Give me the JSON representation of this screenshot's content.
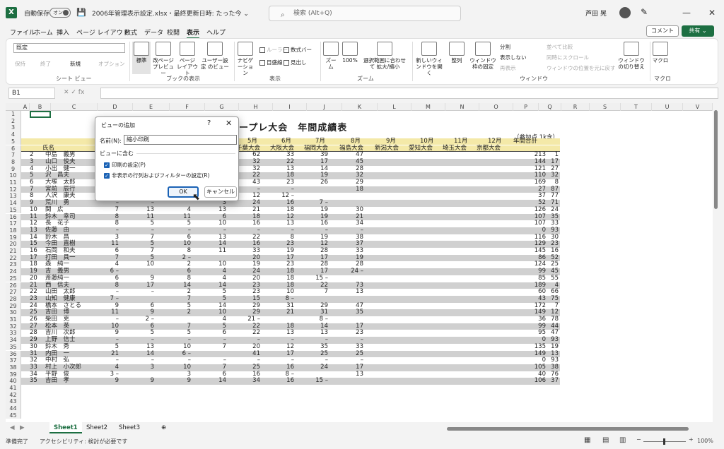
{
  "titlebar": {
    "logo": "X",
    "autosave": "自動保存",
    "toggle": "オン",
    "save_icon": "save-icon",
    "doc_title": "2006年管理表示設定.xlsx・最終更新日時: たった今 ⌄",
    "search_placeholder": "検索 (Alt+Q)",
    "user": "芦田 晃",
    "win_min": "—",
    "win_max": "☐",
    "win_close": "✕"
  },
  "menu": [
    "ファイル",
    "ホーム",
    "挿入",
    "ページ レイアウト",
    "数式",
    "データ",
    "校閲",
    "表示",
    "ヘルプ"
  ],
  "menu_active": "表示",
  "comment_btn": "コメント",
  "share_btn": "共有 ⌄",
  "ribbon": {
    "view_select": "既定",
    "sheetview_small": [
      "保持",
      "終了",
      "新規",
      "オプション"
    ],
    "sheetview_label": "シート ビュー",
    "book_buttons": [
      "標準",
      "改ページ プレビュー",
      "ページ レイアウト",
      "ユーザー設定 のビュー"
    ],
    "book_label": "ブックの表示",
    "show_items": [
      "ナビゲーション",
      "ルーラー",
      "数式バー",
      "目盛線",
      "見出し"
    ],
    "show_label": "表示",
    "zoom_buttons": [
      "ズーム",
      "100%",
      "選択範囲に合わせて 拡大/縮小"
    ],
    "zoom_label": "ズーム",
    "window_buttons": [
      "新しいウィンドウを開く",
      "整列",
      "ウィンドウ枠の固定"
    ],
    "window_small": [
      "分割",
      "表示しない",
      "再表示",
      "並べて比較",
      "同時にスクロール",
      "ウィンドウの位置を元に戻す"
    ],
    "window_switch": "ウィンドウの切り替え",
    "window_label": "ウィンドウ",
    "macro": "マクロ",
    "macro_label": "マクロ"
  },
  "formula": {
    "namebox": "B1",
    "fx": "✕  ✓  fx",
    "value": ""
  },
  "columns": [
    "A",
    "B",
    "C",
    "D",
    "E",
    "F",
    "G",
    "H",
    "I",
    "J",
    "K",
    "L",
    "M",
    "N",
    "O",
    "P",
    "Q",
    "R",
    "S",
    "T",
    "U",
    "V"
  ],
  "sheet_title": "ープレ大会　年間成績表",
  "note": "（参加点 1k含）",
  "header_months": [
    "5月",
    "6月",
    "7月",
    "8月",
    "9月",
    "10月",
    "11月",
    "12月"
  ],
  "header_venues": [
    "千葉大会",
    "大阪大会",
    "福岡大会",
    "福島大会",
    "新潟大会",
    "愛知大会",
    "埼玉大会",
    "京都大会"
  ],
  "header_total": "年間合計",
  "header_name": "氏名",
  "rows": [
    {
      "n": "2",
      "name": "中島　義男",
      "v": [
        "",
        "",
        "",
        "",
        "62",
        "33",
        "39",
        "47"
      ],
      "t": "213",
      "r": "1"
    },
    {
      "n": "3",
      "name": "山口　俊夫",
      "v": [
        "",
        "",
        "",
        "",
        "32",
        "22",
        "17",
        "45"
      ],
      "t": "144",
      "r": "17"
    },
    {
      "n": "4",
      "name": "小出　健一",
      "v": [
        "",
        "",
        "",
        "",
        "32",
        "13",
        "14",
        "28"
      ],
      "t": "121",
      "r": "27"
    },
    {
      "n": "5",
      "name": "沢　昌夫",
      "v": [
        "",
        "",
        "",
        "",
        "22",
        "18",
        "19",
        "32"
      ],
      "t": "110",
      "r": "32"
    },
    {
      "n": "6",
      "name": "大塚　太郎",
      "v": [
        "",
        "",
        "",
        "",
        "43",
        "23",
        "26",
        "29"
      ],
      "t": "169",
      "r": "8"
    },
    {
      "n": "7",
      "name": "宮前　辰行",
      "v": [
        "",
        "",
        "",
        "–",
        "–",
        "–",
        "",
        "18"
      ],
      "t": "27",
      "r": "87"
    },
    {
      "n": "8",
      "name": "人沢　康夫",
      "v": [
        "–",
        "",
        "11",
        "3 –",
        "12",
        "12 –",
        "",
        ""
      ],
      "t": "37",
      "r": "77"
    },
    {
      "n": "9",
      "name": "荒川　勇",
      "v": [
        "–",
        "–",
        "",
        "3",
        "24",
        "16",
        "7 –",
        ""
      ],
      "t": "52",
      "r": "71"
    },
    {
      "n": "10",
      "name": "関　広",
      "v": [
        "7",
        "13",
        "4",
        "13",
        "21",
        "18",
        "19",
        "30"
      ],
      "t": "126",
      "r": "24"
    },
    {
      "n": "11",
      "name": "鈴木　幸司",
      "v": [
        "8",
        "11",
        "11",
        "6",
        "18",
        "12",
        "19",
        "21"
      ],
      "t": "107",
      "r": "35"
    },
    {
      "n": "12",
      "name": "長　花子",
      "v": [
        "8",
        "5",
        "5",
        "10",
        "16",
        "13",
        "16",
        "34"
      ],
      "t": "107",
      "r": "33"
    },
    {
      "n": "13",
      "name": "佐藤　由",
      "v": [
        "–",
        "–",
        "–",
        "–",
        "–",
        "–",
        "–",
        "–"
      ],
      "t": "0",
      "r": "93"
    },
    {
      "n": "14",
      "name": "鈴木　昌",
      "v": [
        "3",
        "7",
        "6",
        "13",
        "22",
        "8",
        "19",
        "38"
      ],
      "t": "116",
      "r": "30"
    },
    {
      "n": "15",
      "name": "今田　直樹",
      "v": [
        "11",
        "5",
        "10",
        "14",
        "16",
        "23",
        "12",
        "37"
      ],
      "t": "129",
      "r": "23"
    },
    {
      "n": "16",
      "name": "石岡　和夫",
      "v": [
        "6",
        "7",
        "8",
        "11",
        "33",
        "19",
        "28",
        "33"
      ],
      "t": "145",
      "r": "16"
    },
    {
      "n": "17",
      "name": "打田　具一",
      "v": [
        "7",
        "5",
        "2 –",
        "",
        "20",
        "17",
        "17",
        "19"
      ],
      "t": "86",
      "r": "52"
    },
    {
      "n": "18",
      "name": "森　純一",
      "v": [
        "4",
        "10",
        "2",
        "10",
        "19",
        "23",
        "28",
        "28"
      ],
      "t": "124",
      "r": "25"
    },
    {
      "n": "19",
      "name": "吉　義男",
      "v": [
        "6 –",
        "",
        "6",
        "4",
        "24",
        "18",
        "17",
        "24 –"
      ],
      "t": "99",
      "r": "45"
    },
    {
      "n": "20",
      "name": "斎藤純一",
      "v": [
        "6",
        "9",
        "8",
        "4",
        "20",
        "18",
        "15 –",
        ""
      ],
      "t": "85",
      "r": "55"
    },
    {
      "n": "21",
      "name": "西　信夫",
      "v": [
        "8",
        "17",
        "14",
        "14",
        "23",
        "18",
        "22",
        "73"
      ],
      "t": "189",
      "r": "4"
    },
    {
      "n": "22",
      "name": "山田　太郎",
      "v": [
        "–",
        "–",
        "2",
        "5",
        "23",
        "10",
        "7",
        "13"
      ],
      "t": "60",
      "r": "66"
    },
    {
      "n": "23",
      "name": "山知　健康",
      "v": [
        "7 –",
        "",
        "7",
        "5",
        "15",
        "8 –",
        "",
        ""
      ],
      "t": "43",
      "r": "75"
    },
    {
      "n": "24",
      "name": "橋本　さとる",
      "v": [
        "9",
        "6",
        "5",
        "14",
        "29",
        "31",
        "29",
        "47"
      ],
      "t": "172",
      "r": "7"
    },
    {
      "n": "25",
      "name": "吉田　博",
      "v": [
        "11",
        "9",
        "2",
        "10",
        "29",
        "21",
        "31",
        "35"
      ],
      "t": "149",
      "r": "12"
    },
    {
      "n": "26",
      "name": "柴田　克",
      "v": [
        "–",
        "2 –",
        "",
        "4",
        "21 –",
        "",
        "8 –",
        ""
      ],
      "t": "36",
      "r": "78"
    },
    {
      "n": "27",
      "name": "松本　英",
      "v": [
        "10",
        "6",
        "7",
        "5",
        "22",
        "18",
        "14",
        "17"
      ],
      "t": "99",
      "r": "44"
    },
    {
      "n": "28",
      "name": "吉川　次郎",
      "v": [
        "9",
        "5",
        "5",
        "6",
        "22",
        "13",
        "13",
        "23"
      ],
      "t": "95",
      "r": "47"
    },
    {
      "n": "29",
      "name": "上野　信士",
      "v": [
        "–",
        "–",
        "–",
        "–",
        "–",
        "–",
        "–",
        "–"
      ],
      "t": "0",
      "r": "93"
    },
    {
      "n": "30",
      "name": "鈴木　秀",
      "v": [
        "5",
        "13",
        "10",
        "7",
        "20",
        "12",
        "35",
        "33"
      ],
      "t": "135",
      "r": "19"
    },
    {
      "n": "31",
      "name": "内田　一",
      "v": [
        "21",
        "14",
        "6 –",
        "",
        "41",
        "17",
        "25",
        "25"
      ],
      "t": "149",
      "r": "13"
    },
    {
      "n": "32",
      "name": "中村　弘",
      "v": [
        "–",
        "–",
        "–",
        "–",
        "–",
        "–",
        "–",
        "–"
      ],
      "t": "0",
      "r": "93"
    },
    {
      "n": "33",
      "name": "村上　小次郎",
      "v": [
        "4",
        "3",
        "10",
        "7",
        "25",
        "16",
        "24",
        "17"
      ],
      "t": "105",
      "r": "38"
    },
    {
      "n": "34",
      "name": "平野　俊",
      "v": [
        "3 –",
        "",
        "3",
        "6",
        "16",
        "8 –",
        "",
        "13"
      ],
      "t": "40",
      "r": "76"
    },
    {
      "n": "35",
      "name": "吉田　孝",
      "v": [
        "9",
        "9",
        "9",
        "14",
        "34",
        "16",
        "15 –",
        ""
      ],
      "t": "106",
      "r": "37"
    }
  ],
  "tabs": [
    "Sheet1",
    "Sheet2",
    "Sheet3"
  ],
  "status": {
    "ready": "準備完了",
    "accessibility": "アクセシビリティ: 検討が必要です",
    "zoom": "100%"
  },
  "dialog": {
    "title": "ビューの追加",
    "help": "?",
    "close": "✕",
    "name_label": "名前(N):",
    "name_value": "縮小印刷",
    "include_label": "ビューに含む",
    "check1": "印刷の設定(P)",
    "check2": "非表示の行列およびフィルターの設定(R)",
    "ok": "OK",
    "cancel": "キャンセル"
  }
}
